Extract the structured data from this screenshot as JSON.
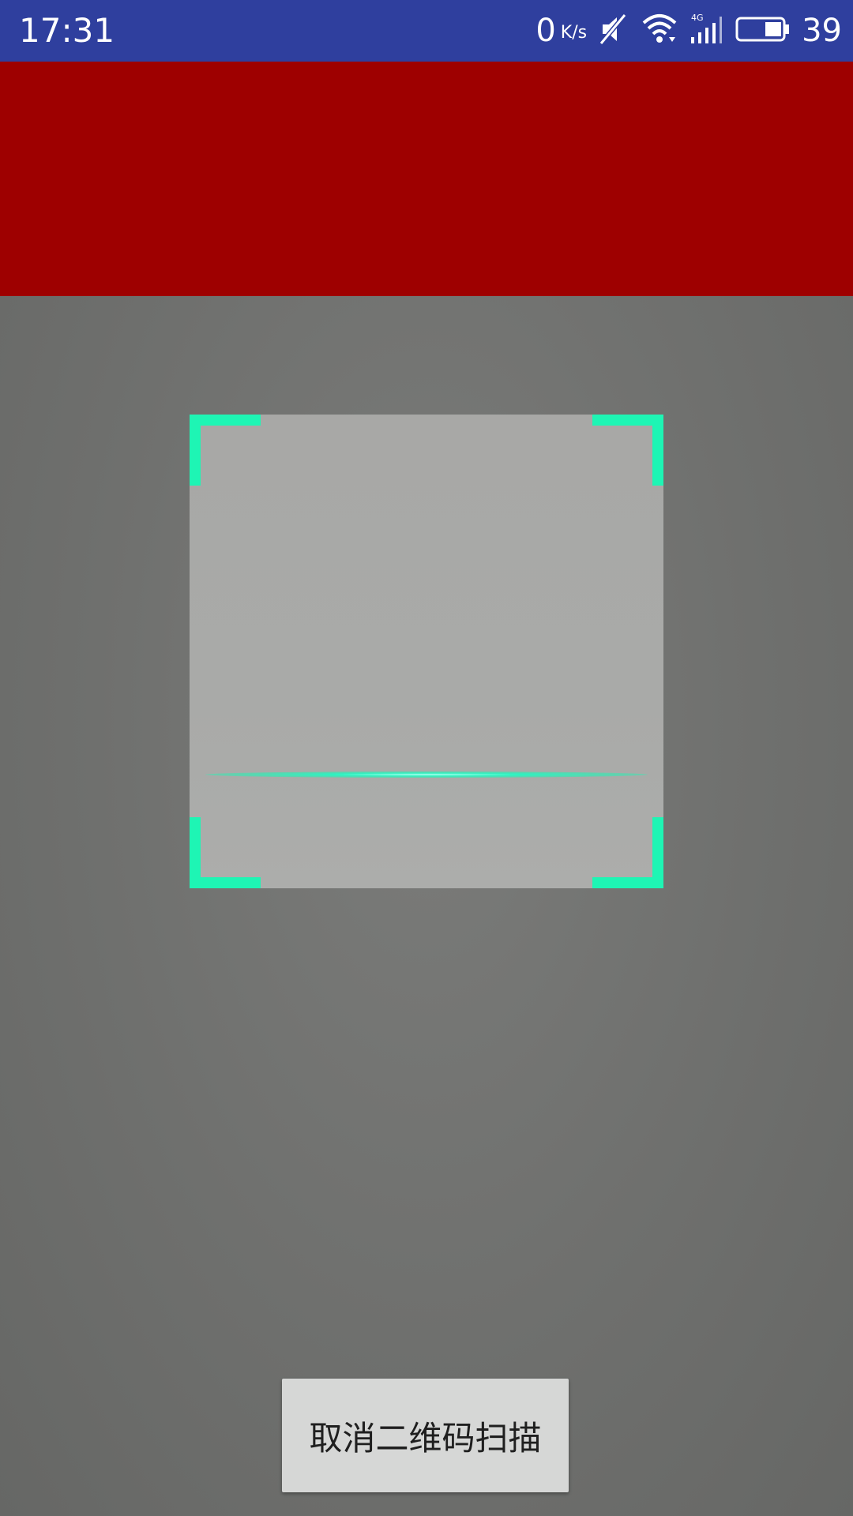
{
  "status_bar": {
    "time": "17:31",
    "net_speed_value": "0",
    "net_speed_unit": "K/s",
    "battery_percent": "39",
    "icons": [
      "mute-icon",
      "wifi-icon",
      "cellular-4g-icon",
      "battery-icon"
    ],
    "background_color": "#2f3f9e"
  },
  "banner": {
    "background_color": "#9e0000"
  },
  "scanner": {
    "accent_color": "#1ef5b4",
    "scan_line_progress": 0.76
  },
  "actions": {
    "cancel_label": "取消二维码扫描"
  }
}
